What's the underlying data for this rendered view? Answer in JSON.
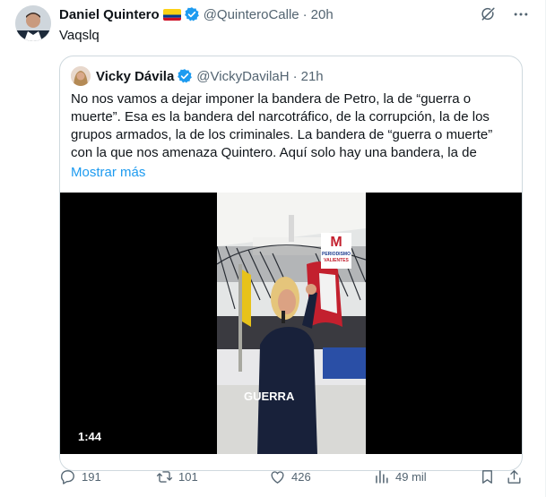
{
  "tweet": {
    "author_name": "Daniel Quintero",
    "handle": "@QuinteroCalle",
    "separator": "·",
    "time": "20h",
    "text": "Vaqslq"
  },
  "quote": {
    "author_name": "Vicky Dávila",
    "handle": "@VickyDavilaH",
    "separator": "·",
    "time": "21h",
    "text": "No nos vamos a dejar imponer la bandera de Petro, la de “guerra o muerte”. Esa es la bandera del narcotráfico, de la corrupción, la de los grupos armados, la de los criminales. La bandera de “guerra o muerte” con la que nos amenaza Quintero. Aquí solo hay una bandera, la de",
    "show_more": "Mostrar más",
    "video": {
      "duration": "1:44",
      "caption": "GUERRA",
      "logo_text": "PERIODISMO VALIENTES"
    }
  },
  "actions": {
    "replies": "191",
    "retweets": "101",
    "likes": "426",
    "views": "49 mil"
  },
  "colors": {
    "accent": "#1d9bf0",
    "secondary_text": "#536471",
    "border": "#cfd9de"
  },
  "icons": [
    "grok-icon",
    "more-icon",
    "verified-badge-icon",
    "colombia-flag-icon",
    "reply-icon",
    "retweet-icon",
    "like-icon",
    "views-icon",
    "bookmark-icon",
    "share-icon"
  ]
}
